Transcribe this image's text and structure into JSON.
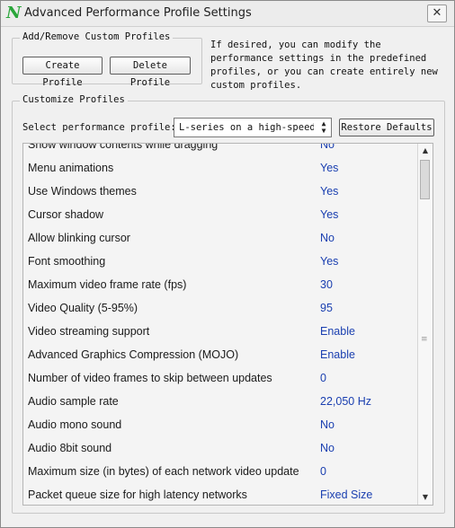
{
  "window": {
    "title": "Advanced Performance Profile Settings",
    "close_glyph": "✕"
  },
  "add_remove": {
    "legend": "Add/Remove Custom Profiles",
    "create_label": "Create Profile",
    "delete_label": "Delete Profile",
    "description": "If desired, you can modify the performance settings in the predefined profiles, or you can create entirely new custom profiles."
  },
  "customize": {
    "legend": "Customize Profiles",
    "select_label": "Select performance profile:",
    "selected_profile": "L-series on a high-speed :",
    "restore_label": "Restore Defaults"
  },
  "settings": [
    {
      "label": "Show window contents while dragging",
      "value": "No"
    },
    {
      "label": "Menu animations",
      "value": "Yes"
    },
    {
      "label": "Use Windows themes",
      "value": "Yes"
    },
    {
      "label": "Cursor shadow",
      "value": "Yes"
    },
    {
      "label": "Allow blinking cursor",
      "value": "No"
    },
    {
      "label": "Font smoothing",
      "value": "Yes"
    },
    {
      "label": "Maximum video frame rate (fps)",
      "value": "30"
    },
    {
      "label": "Video Quality (5-95%)",
      "value": "95"
    },
    {
      "label": "Video streaming support",
      "value": "Enable"
    },
    {
      "label": "Advanced Graphics Compression (MOJO)",
      "value": "Enable"
    },
    {
      "label": "Number of video frames to skip between updates",
      "value": "0"
    },
    {
      "label": "Audio sample rate",
      "value": "22,050 Hz"
    },
    {
      "label": "Audio mono sound",
      "value": "No"
    },
    {
      "label": "Audio 8bit sound",
      "value": "No"
    },
    {
      "label": "Maximum size (in bytes) of each network video update",
      "value": "0"
    },
    {
      "label": "Packet queue size for high latency networks",
      "value": "Fixed Size"
    }
  ],
  "colors": {
    "value_text": "#1a3fb0",
    "app_icon": "#2aa63a"
  }
}
